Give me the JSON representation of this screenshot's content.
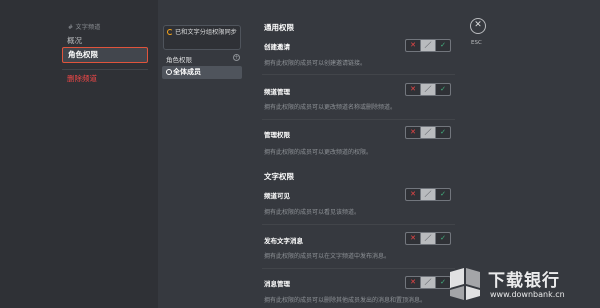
{
  "sidebar": {
    "header": "# 文字频道",
    "items": [
      {
        "label": "概况"
      },
      {
        "label": "角色权限"
      },
      {
        "label": "删除频道"
      }
    ]
  },
  "roles": {
    "sync_notice": "已和文字分组权限同步",
    "section_label": "角色权限",
    "add_icon": "plus-circle-icon",
    "selected_role": "全体成员"
  },
  "general": {
    "title": "通用权限",
    "perms": [
      {
        "name": "创建邀请",
        "desc": "拥有此权限的成员可以创建邀请链接。"
      },
      {
        "name": "频道管理",
        "desc": "拥有此权限的成员可以更改频道名称或删除频道。"
      },
      {
        "name": "管理权限",
        "desc": "拥有此权限的成员可以更改频道的权限。"
      }
    ]
  },
  "text": {
    "title": "文字权限",
    "perms": [
      {
        "name": "频道可见",
        "desc": "拥有此权限的成员可以看见该频道。"
      },
      {
        "name": "发布文字消息",
        "desc": "拥有此权限的成员可以在文字频道中发布消息。"
      },
      {
        "name": "消息管理",
        "desc": "拥有此权限的成员可以删除其他成员发出的消息和置顶消息。"
      }
    ]
  },
  "toggle": {
    "deny": "✕",
    "pass": "／",
    "allow": "✓"
  },
  "close": {
    "icon": "✕",
    "label": "ESC"
  },
  "watermark": {
    "title": "下载银行",
    "url": "www.downbank.cn"
  },
  "colors": {
    "deny": "#f04747",
    "allow": "#43b581",
    "accent": "#e0543c",
    "background": "#36393f"
  }
}
